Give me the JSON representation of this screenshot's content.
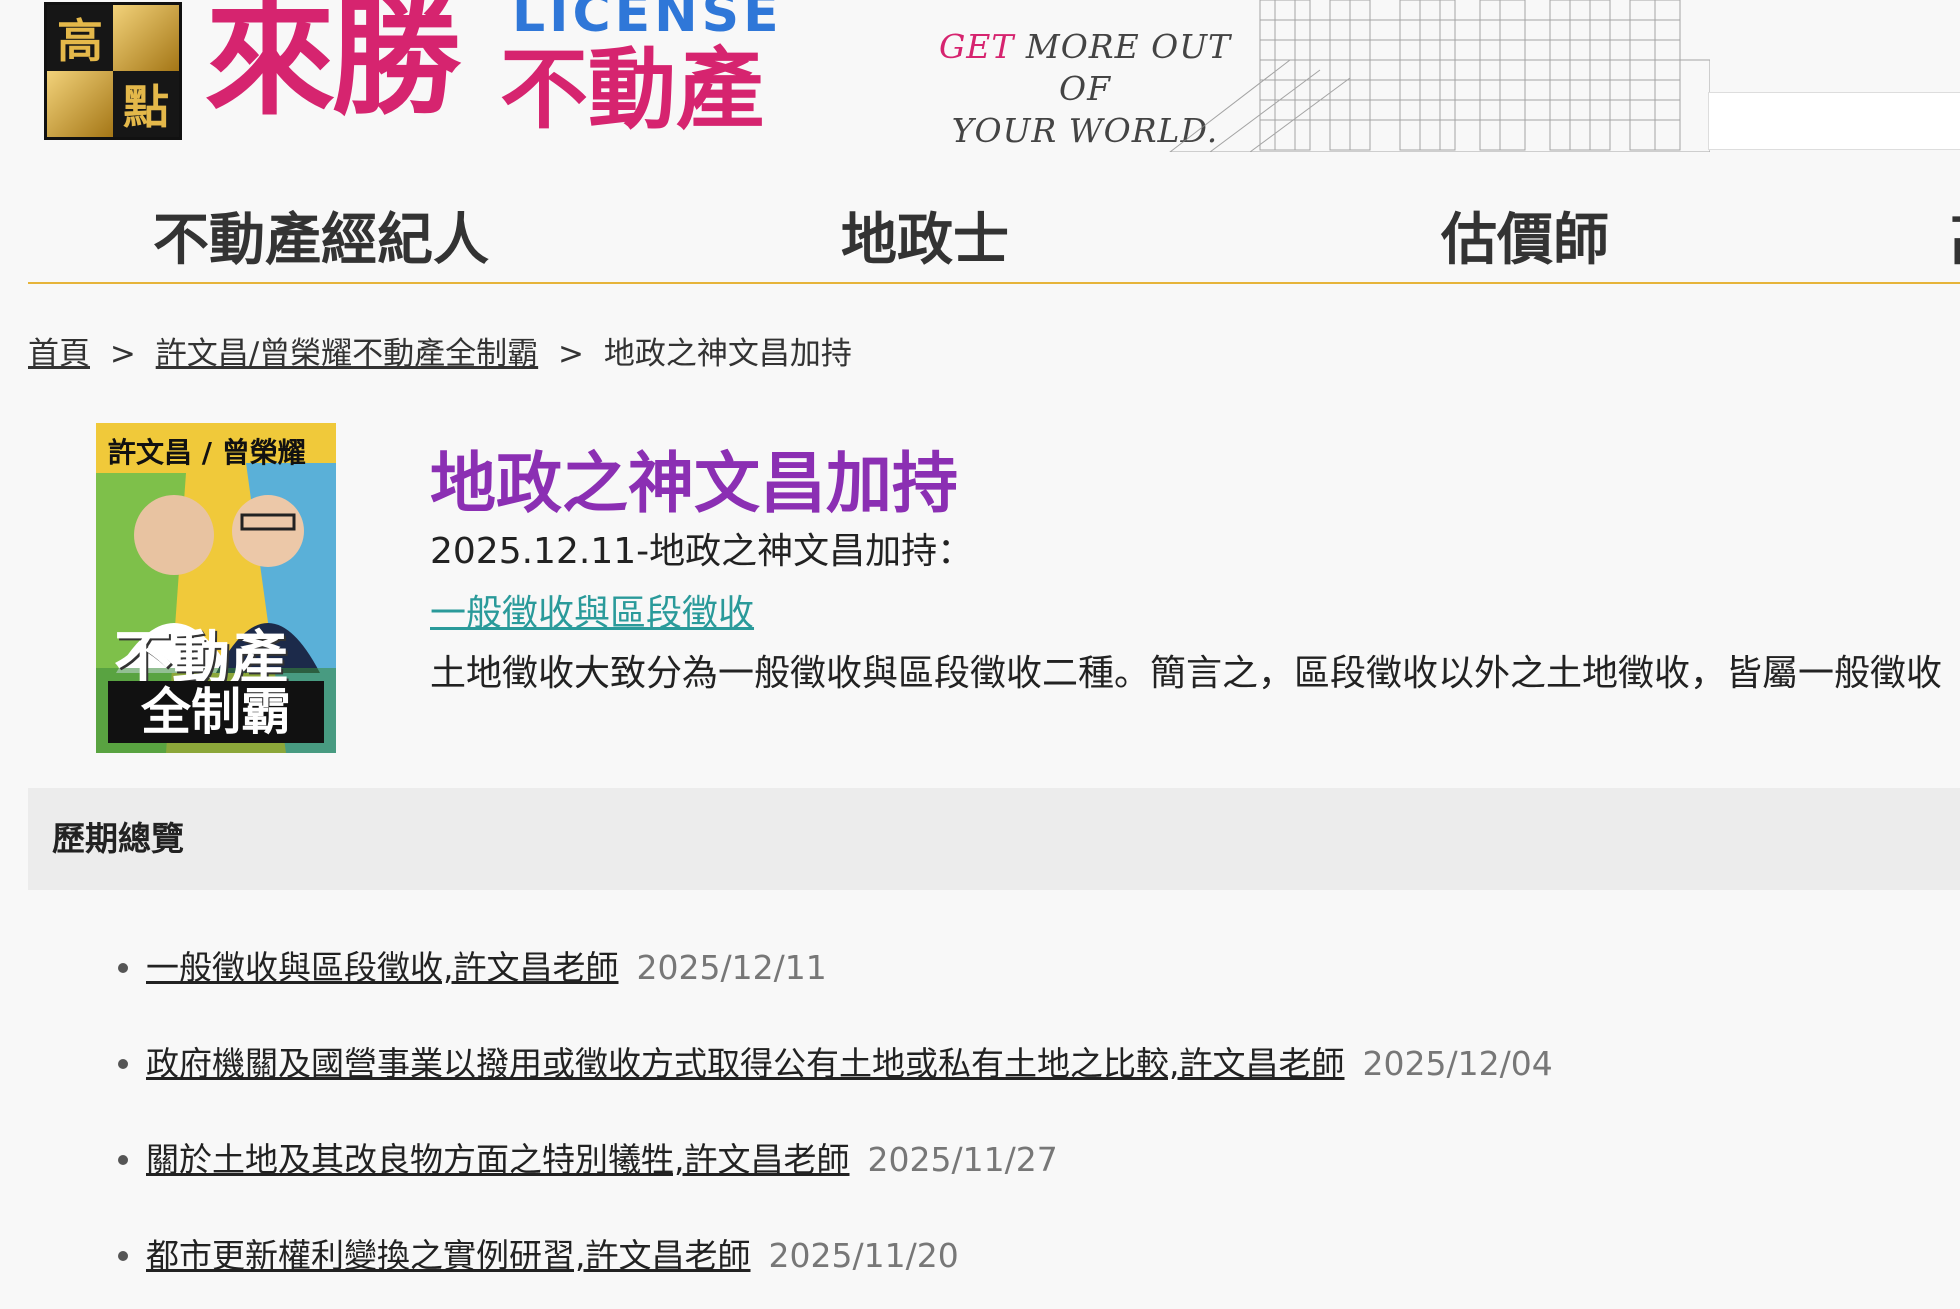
{
  "header": {
    "logo_chars": [
      "高",
      "",
      "",
      "點"
    ],
    "brand_name": "來勝",
    "brand_license": "LICENSE",
    "brand_sub": "不動產",
    "slogan_get": "GET",
    "slogan_rest": "MORE OUT OF",
    "slogan_line2": "YOUR WORLD."
  },
  "nav": {
    "items": [
      {
        "label": "不動產經紀人"
      },
      {
        "label": "地政士"
      },
      {
        "label": "估價師"
      },
      {
        "label": "高"
      }
    ]
  },
  "breadcrumb": {
    "home": "首頁",
    "sep1": ">",
    "category": "許文昌/曾榮耀不動產全制霸",
    "sep2": ">",
    "current": "地政之神文昌加持"
  },
  "thumbnail": {
    "names": "許文昌 / 曾榮耀",
    "line1": "不動產",
    "line2": "全制霸"
  },
  "article": {
    "title": "地政之神文昌加持",
    "date_line": "2025.12.11-地政之神文昌加持：",
    "link_text": "一般徵收與區段徵收",
    "body": "土地徵收大致分為一般徵收與區段徵收二種。簡言之，區段徵收以外之土地徵收，皆屬一般徵收"
  },
  "archive": {
    "heading": "歷期總覽",
    "items": [
      {
        "title": "一般徵收與區段徵收,許文昌老師",
        "date": "2025/12/11"
      },
      {
        "title": "政府機關及國營事業以撥用或徵收方式取得公有土地或私有土地之比較,許文昌老師",
        "date": "2025/12/04"
      },
      {
        "title": "關於土地及其改良物方面之特別犧牲,許文昌老師",
        "date": "2025/11/27"
      },
      {
        "title": "都市更新權利變換之實例研習,許文昌老師",
        "date": "2025/11/20"
      }
    ]
  },
  "colors": {
    "brand_pink": "#d6246f",
    "license_blue": "#2f77d8",
    "title_purple": "#8b2fb3",
    "link_teal": "#2a9a9a",
    "nav_underline": "#e6b43a"
  }
}
